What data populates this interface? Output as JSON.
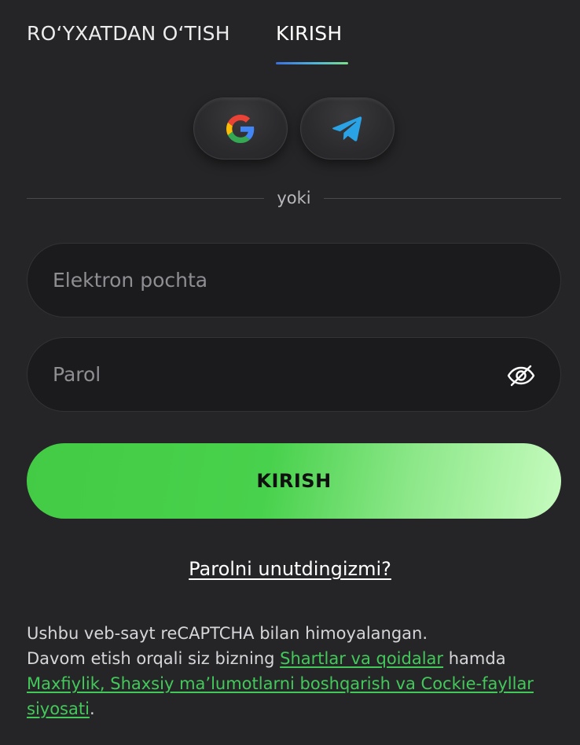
{
  "tabs": {
    "register_label": "RO‘YXATDAN O‘TISH",
    "login_label": "KIRISH"
  },
  "social": {
    "google_icon": "google-icon",
    "telegram_icon": "telegram-icon"
  },
  "divider": {
    "text": "yoki"
  },
  "form": {
    "email_placeholder": "Elektron pochta",
    "email_value": "",
    "password_placeholder": "Parol",
    "password_value": "",
    "password_toggle_icon": "eye-slash-icon",
    "submit_label": "KIRISH"
  },
  "forgot": {
    "link_text": "Parolni unutdingizmi?"
  },
  "legal": {
    "line1": "Ushbu veb-sayt reCAPTCHA bilan himoyalangan.",
    "line2_prefix": "Davom etish orqali siz bizning ",
    "terms_link": "Shartlar va qoidalar",
    "line2_suffix": " hamda",
    "privacy_link": "Maxfiylik, Shaxsiy ma’lumotlarni boshqarish va Cockie-fayllar siyosati",
    "end": "."
  },
  "colors": {
    "background": "#252527",
    "accent_green": "#44cb45",
    "link_green": "#42c95a",
    "tab_underline_start": "#3b6fe0",
    "tab_underline_end": "#7be08a"
  }
}
